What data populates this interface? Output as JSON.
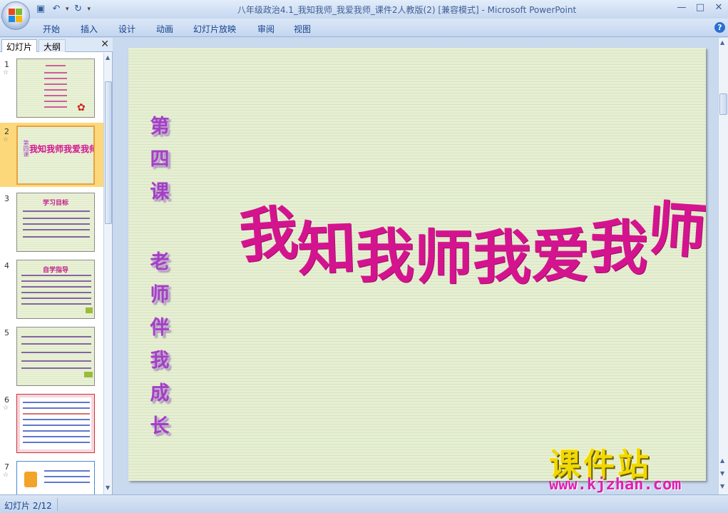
{
  "window": {
    "title": "八年级政治4.1_我知我师_我爱我师_课件2人教版(2) [兼容模式] - Microsoft PowerPoint",
    "controls": [
      "—",
      "□",
      "✕"
    ]
  },
  "quick_access": {
    "save_icon": "save-icon",
    "undo_icon": "undo-icon",
    "redo_icon": "redo-icon"
  },
  "menu": {
    "items": [
      "开始",
      "插入",
      "设计",
      "动画",
      "幻灯片放映",
      "审阅",
      "视图"
    ]
  },
  "left_pane": {
    "tabs": [
      "幻灯片",
      "大纲"
    ],
    "close_glyph": "✕",
    "thumbnails": [
      {
        "num": "1",
        "title": ""
      },
      {
        "num": "2",
        "title": "我知我师我爱我师"
      },
      {
        "num": "3",
        "title": "学习目标"
      },
      {
        "num": "4",
        "title": "自学指导"
      },
      {
        "num": "5",
        "title": ""
      },
      {
        "num": "6",
        "title": ""
      },
      {
        "num": "7",
        "title": ""
      }
    ],
    "selected_index": 1
  },
  "slide": {
    "left_column_top": [
      "第",
      "四",
      "课"
    ],
    "left_column_bottom": [
      "老",
      "师",
      "伴",
      "我",
      "成",
      "长"
    ],
    "main_title_chars": [
      "我",
      "知",
      "我",
      "师",
      "我",
      "爱",
      "我",
      "师"
    ]
  },
  "watermark": {
    "brand": "课件站",
    "url": "www.kjzhan.com"
  },
  "status": {
    "slide_counter": "幻灯片 2/12"
  },
  "colors": {
    "accent_title": "#d4148f",
    "accent_vertical": "#a43fc4",
    "watermark_brand": "#f0d800",
    "watermark_url": "#e01fb0"
  }
}
